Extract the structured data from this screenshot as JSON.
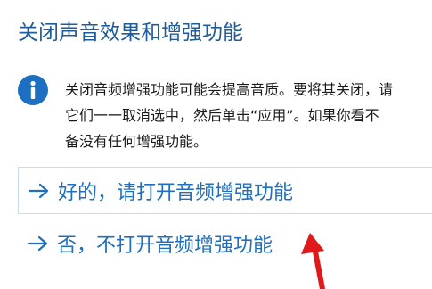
{
  "title": "关闭声音效果和增强功能",
  "info": {
    "icon": "info-icon",
    "lines": [
      "关闭音频增强功能可能会提高音质。要将其关闭，请",
      "它们一一取消选中，然后单击“应用”。如果你看不",
      "备没有任何增强功能。"
    ]
  },
  "options": [
    {
      "label": "好的，请打开音频增强功能",
      "icon": "right-arrow-icon"
    },
    {
      "label": "否，不打开音频增强功能",
      "icon": "right-arrow-icon"
    }
  ],
  "colors": {
    "title": "#1f5c9a",
    "accent": "#1f6fbf",
    "info_icon_bg": "#1d6fc2",
    "annotation_arrow": "#e01a1a"
  }
}
